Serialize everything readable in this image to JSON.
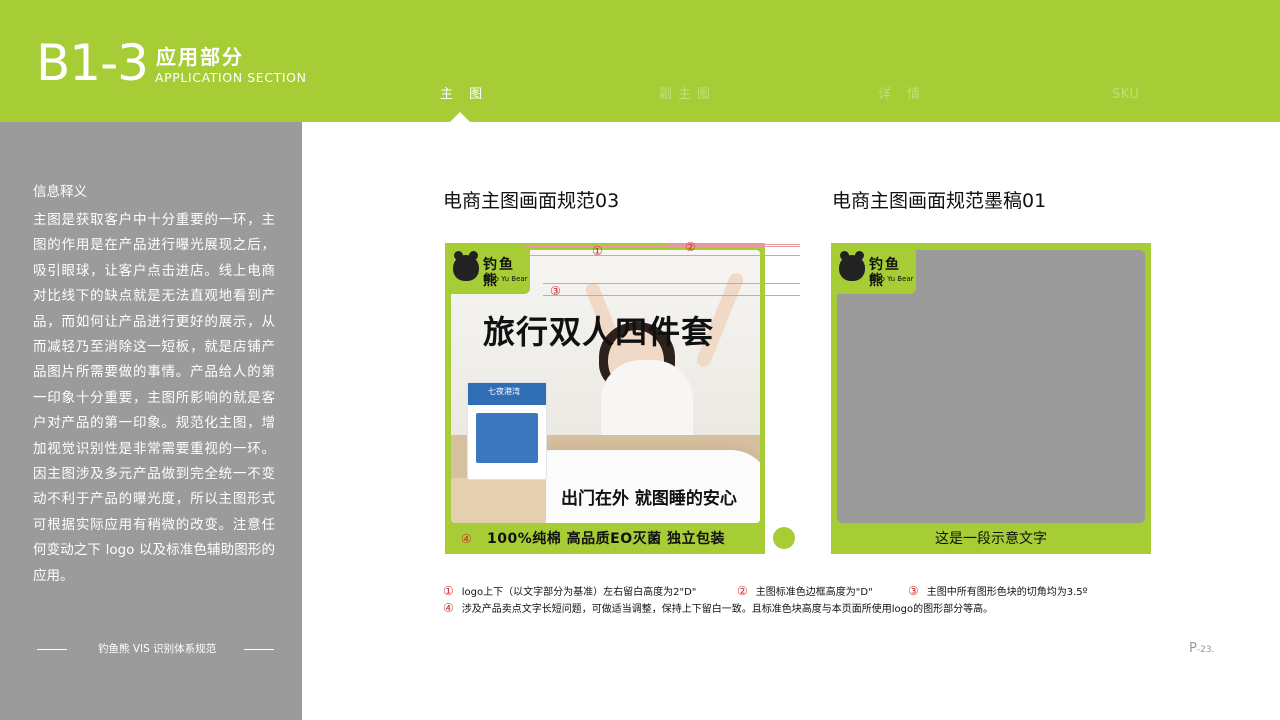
{
  "header": {
    "code": "B1-3",
    "section_cn": "应用部分",
    "section_en": "APPLICATION SECTION",
    "tabs": [
      {
        "label": "主 图",
        "active": true
      },
      {
        "label": "副主图",
        "active": false
      },
      {
        "label": "详 情",
        "active": false
      },
      {
        "label": "SKU",
        "active": false
      }
    ]
  },
  "sidebar": {
    "title": "信息释义",
    "body": "主图是获取客户中十分重要的一环，主图的作用是在产品进行曝光展现之后，吸引眼球，让客户点击进店。线上电商对比线下的缺点就是无法直观地看到产品，而如何让产品进行更好的展示，从而减轻乃至消除这一短板，就是店铺产品图片所需要做的事情。产品给人的第一印象十分重要，主图所影响的就是客户对产品的第一印象。规范化主图，增加视觉识别性是非常需要重视的一环。因主图涉及多元产品做到完全统一不变动不利于产品的曝光度，所以主图形式可根据实际应用有稍微的改变。注意任何变动之下 logo 以及标准色辅助图形的应用。",
    "footer": "钓鱼熊 VIS 识别体系规范"
  },
  "main": {
    "left_title": "电商主图画面规范03",
    "right_title": "电商主图画面规范墨稿01",
    "logo_cn": "钓鱼熊",
    "logo_en": "Diao Yu Bear",
    "package_text": "七夜港湾",
    "headline": "旅行双人四件套",
    "subline": "出门在外 就图睡的安心",
    "selling_points": "100%纯棉   高品质EO灭菌   独立包装",
    "draft_text": "这是一段示意文字",
    "markers": [
      "①",
      "②",
      "③",
      "④"
    ]
  },
  "notes": {
    "n1": "logo上下（以文字部分为基准）左右留白高度为2\"D\"",
    "n2": "主图标准色边框高度为\"D\"",
    "n3": "主图中所有图形色块的切角均为3.5º",
    "n4": "涉及产品卖点文字长短问题，可做适当调整，保持上下留白一致。且标准色块高度与本页面所使用logo的图形部分等高。"
  },
  "page": {
    "prefix": "P",
    "number": "-23."
  },
  "colors": {
    "brand_green": "#a6cd36",
    "sidebar_gray": "#9c9b9c",
    "marker_red": "#d13030"
  }
}
